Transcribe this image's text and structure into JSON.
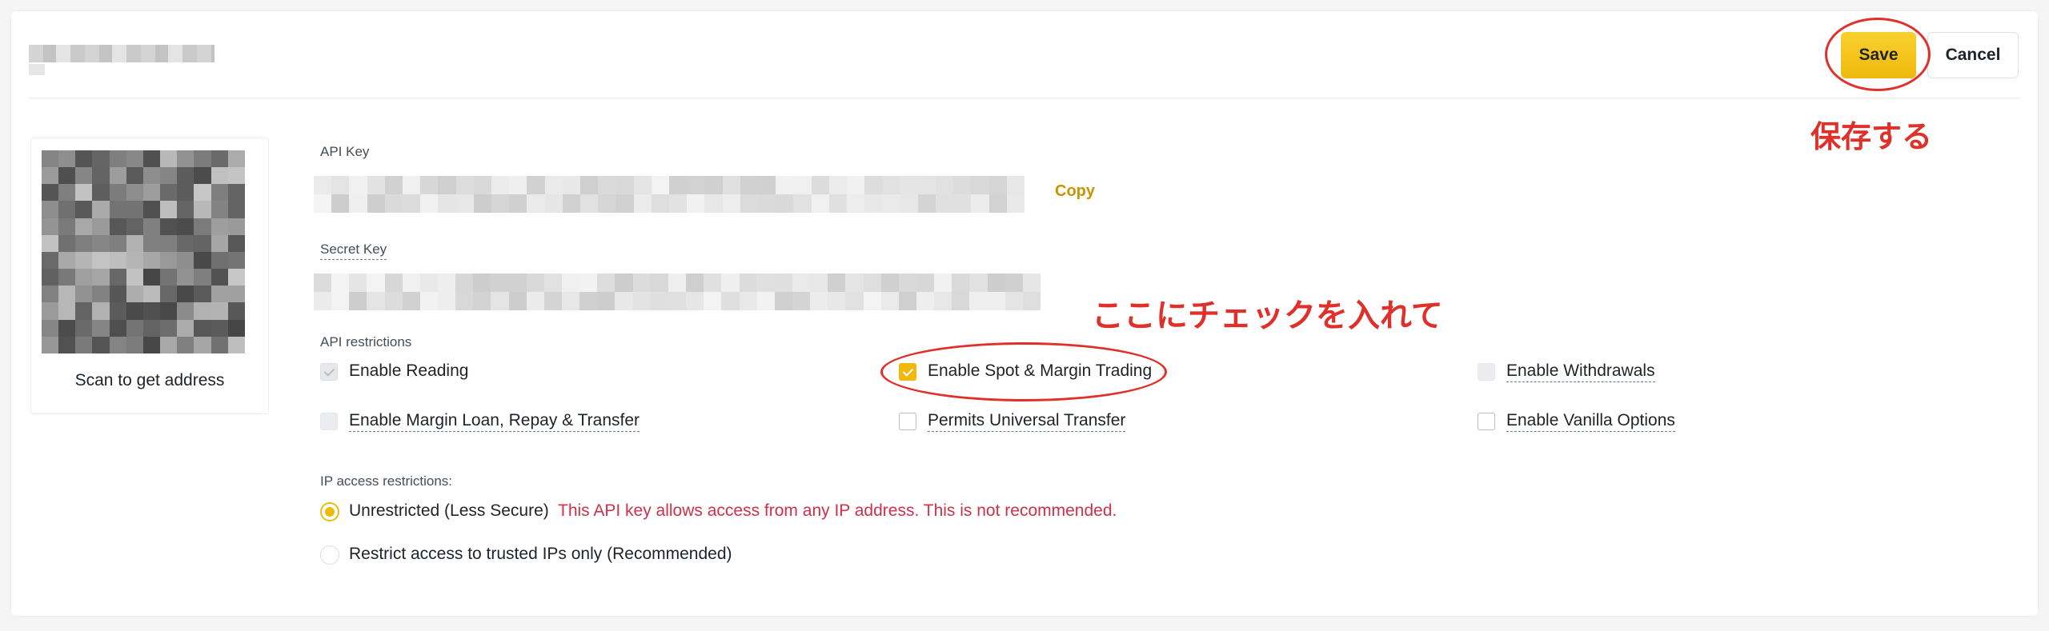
{
  "header": {
    "save_label": "Save",
    "cancel_label": "Cancel",
    "save_annotation": "保存する"
  },
  "qr": {
    "caption": "Scan to get address"
  },
  "api_key": {
    "label": "API Key",
    "copy_label": "Copy"
  },
  "secret_key": {
    "label": "Secret Key"
  },
  "restrictions": {
    "label": "API restrictions",
    "annotation": "ここにチェックを入れて",
    "options": [
      {
        "label": "Enable Reading",
        "state": "checked-disabled"
      },
      {
        "label": "Enable Spot & Margin Trading",
        "state": "checked"
      },
      {
        "label": "Enable Withdrawals",
        "state": "disabled"
      },
      {
        "label": "Enable Margin Loan, Repay & Transfer",
        "state": "disabled"
      },
      {
        "label": "Permits Universal Transfer",
        "state": "unchecked"
      },
      {
        "label": "Enable Vanilla Options",
        "state": "unchecked"
      }
    ]
  },
  "ip_access": {
    "label": "IP access restrictions:",
    "options": [
      {
        "label": "Unrestricted (Less Secure)",
        "selected": true
      },
      {
        "label": "Restrict access to trusted IPs only (Recommended)",
        "selected": false
      }
    ],
    "warning": "This API key allows access from any IP address. This is not recommended."
  },
  "colors": {
    "accent": "#f0b90b",
    "annotation_red": "#e0302a",
    "warning_red": "#cf304a",
    "copy_gold": "#c99400"
  }
}
